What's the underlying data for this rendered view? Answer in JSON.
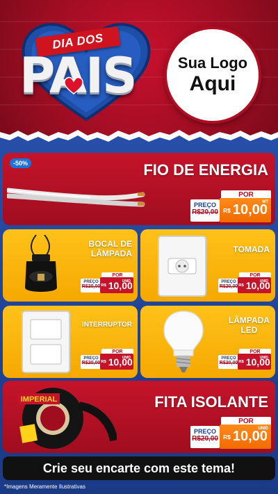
{
  "header": {
    "ribbon_text": "DIA DOS",
    "title": "PAIS",
    "logo_line1": "Sua Logo",
    "logo_line2": "Aqui",
    "colors": {
      "red": "#c8102e",
      "blue": "#1f3f8f",
      "yellow": "#ffc21a"
    }
  },
  "products": [
    {
      "name": "FIO DE ENERGIA",
      "badge": "-50%",
      "por": "POR",
      "preco_label": "PREÇO",
      "old_price": "R$20,00",
      "currency": "R$",
      "price": "10,00",
      "unit": "MT",
      "image": "wire-image"
    },
    {
      "name_line1": "BOCAL DE",
      "name_line2": "LÂMPADA",
      "por": "POR",
      "preco_label": "PREÇO",
      "old_price": "R$20,00",
      "currency": "R$",
      "price": "10,00",
      "unit": "UNID",
      "image": "socket-image"
    },
    {
      "name": "TOMADA",
      "por": "POR",
      "preco_label": "PREÇO",
      "old_price": "R$20,00",
      "currency": "R$",
      "price": "10,00",
      "unit": "UNID",
      "image": "outlet-image"
    },
    {
      "name": "INTERRUPTOR",
      "por": "POR",
      "preco_label": "PREÇO",
      "old_price": "R$20,00",
      "currency": "R$",
      "price": "10,00",
      "unit": "UNID",
      "image": "switch-image"
    },
    {
      "name_line1": "LÂMPADA",
      "name_line2": "LED",
      "por": "POR",
      "preco_label": "PREÇO",
      "old_price": "R$20,00",
      "currency": "R$",
      "price": "10,00",
      "unit": "UNID",
      "image": "bulb-image"
    },
    {
      "name": "FITA ISOLANTE",
      "por": "POR",
      "preco_label": "PREÇO",
      "old_price": "R$20,00",
      "currency": "R$",
      "price": "10,00",
      "unit": "UNID",
      "image": "tape-image",
      "tape_brand": "IMPERIAL"
    }
  ],
  "cta": "Crie seu encarte com este tema!",
  "disclaimer": "*Imagens Meramente Ilustrativas"
}
